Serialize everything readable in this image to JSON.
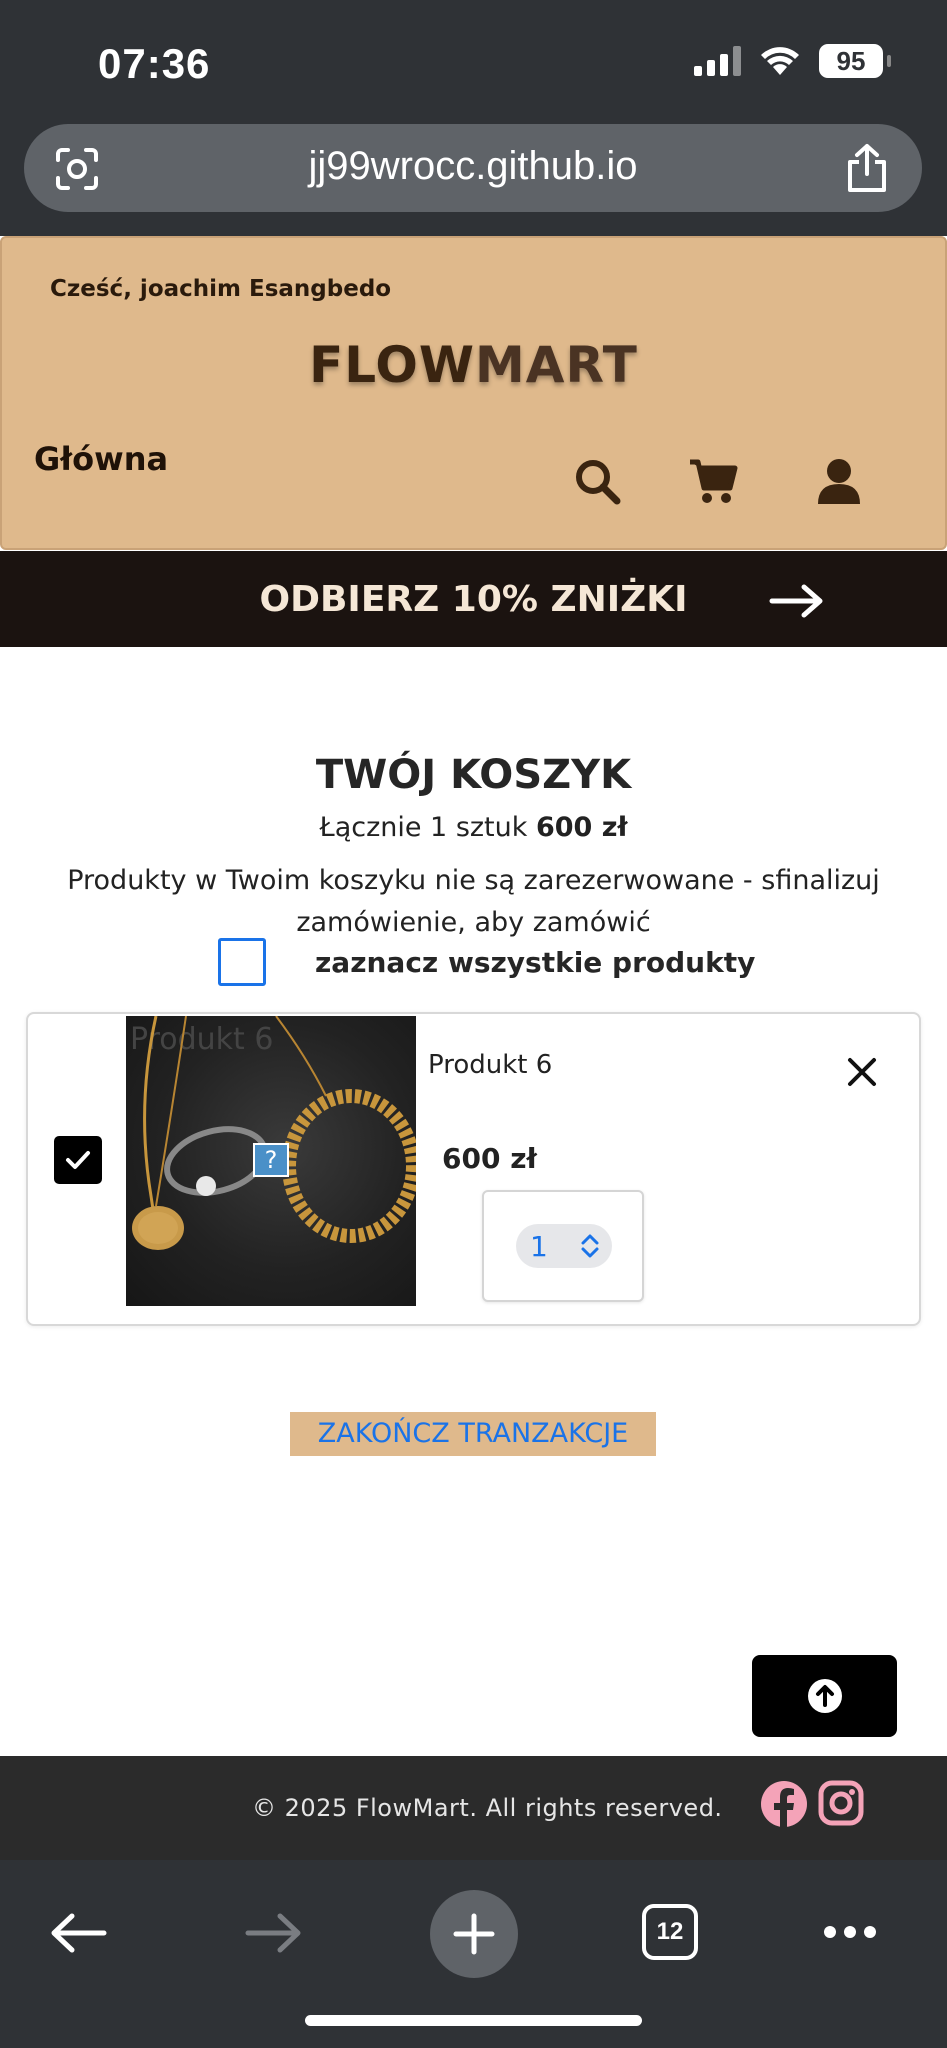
{
  "status_bar": {
    "time": "07:36",
    "battery": "95"
  },
  "browser": {
    "url": "jj99wrocc.github.io",
    "tab_count": "12"
  },
  "header": {
    "greeting": "Cześć, joachim Esangbedo",
    "logo_bold": "FLOW",
    "logo_rest": "MART",
    "nav_home": "Główna",
    "bg_color": "#dfb98c"
  },
  "promo": {
    "text": "ODBIERZ 10% ZNIŻKI"
  },
  "cart": {
    "title": "TWÓJ KOSZYK",
    "total_prefix": "Łącznie 1 sztuk ",
    "total_amount": "600 zł",
    "note": "Produkty w Twoim koszyku nie są zarezerwowane - sfinalizuj zamówienie, aby zamówić",
    "select_all_label": "zaznacz wszystkie produkty",
    "select_all_checked": false,
    "items": [
      {
        "image_alt": "Produkt 6",
        "name": "Produkt 6",
        "price": "600 zł",
        "quantity": "1",
        "checked": true
      }
    ],
    "checkout_label": "ZAKOŃCZ TRANZAKCJE"
  },
  "footer": {
    "copyright": "© 2025 FlowMart. All rights reserved."
  },
  "colors": {
    "accent_blue": "#1a73e8",
    "facebook_pink": "#f4a3b8",
    "instagram_pink": "#f4a3b8"
  }
}
